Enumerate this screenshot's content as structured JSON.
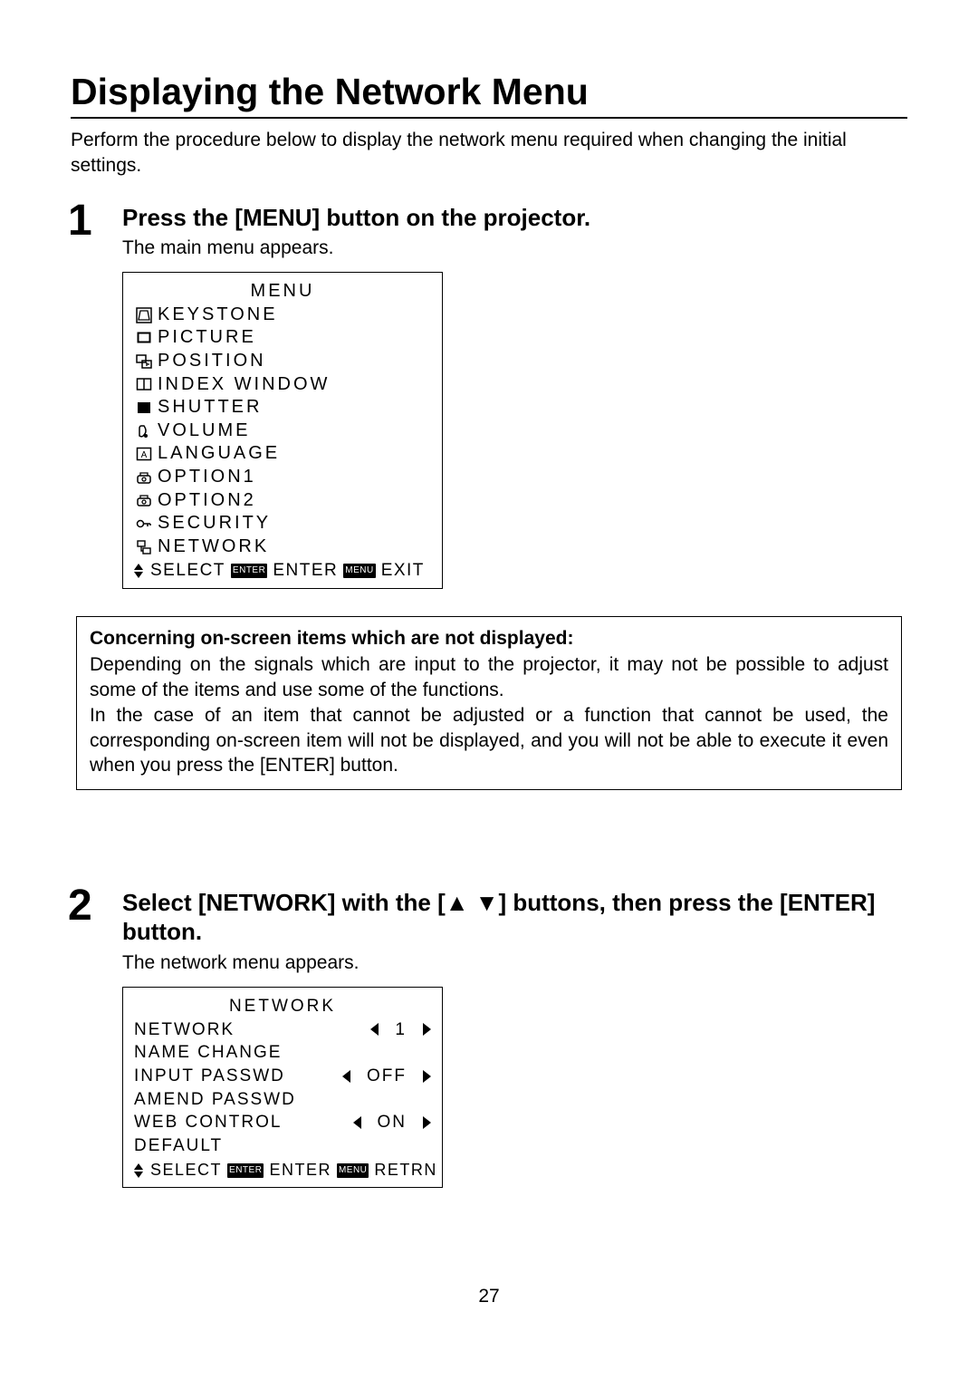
{
  "title": "Displaying the Network Menu",
  "intro": "Perform the procedure below to display the network menu required when changing the initial settings.",
  "step1": {
    "num": "1",
    "title": "Press the [MENU] button on the projector.",
    "desc": "The main menu appears."
  },
  "menu": {
    "title": "MENU",
    "items": {
      "keystone": "KEYSTONE",
      "picture": "PICTURE",
      "position": "POSITION",
      "index_window": "INDEX WINDOW",
      "shutter": "SHUTTER",
      "volume": "VOLUME",
      "language": "LANGUAGE",
      "option1": "OPTION1",
      "option2": "OPTION2",
      "security": "SECURITY",
      "network": "NETWORK"
    },
    "foot": {
      "select": "SELECT",
      "enter_tag": "ENTER",
      "enter": "ENTER",
      "menu_tag": "MENU",
      "exit": "EXIT"
    }
  },
  "note": {
    "title": "Concerning on-screen items which are not displayed:",
    "p1": "Depending on the signals which are input to the projector, it may not be possible to adjust some of the items and use some of the functions.",
    "p2": "In the case of an item that cannot be adjusted or a function that cannot be used, the corresponding on-screen item will not be displayed, and you will not be able to execute it even when you press the [ENTER] button."
  },
  "step2": {
    "num": "2",
    "title": "Select [NETWORK] with the [▲ ▼] buttons, then press the [ENTER] button.",
    "desc": "The network menu appears."
  },
  "network_menu": {
    "title": "NETWORK",
    "rows": {
      "network": {
        "label": "NETWORK",
        "value": "1"
      },
      "name_change": {
        "label": "NAME CHANGE"
      },
      "input_passwd": {
        "label": "INPUT PASSWD",
        "value": "OFF"
      },
      "amend_passwd": {
        "label": "AMEND PASSWD"
      },
      "web_control": {
        "label": "WEB CONTROL",
        "value": "ON"
      },
      "default": {
        "label": "DEFAULT"
      }
    },
    "foot": {
      "select": "SELECT",
      "enter_tag": "ENTER",
      "enter": "ENTER",
      "menu_tag": "MENU",
      "retrn": "RETRN"
    }
  },
  "page_number": "27"
}
